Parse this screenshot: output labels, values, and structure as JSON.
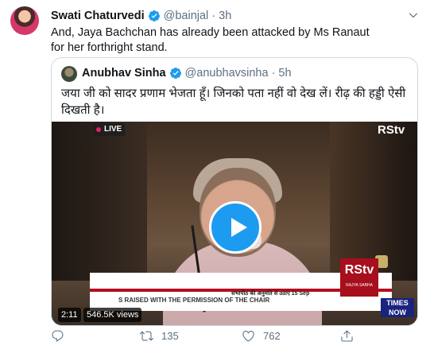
{
  "tweet": {
    "author_name": "Swati Chaturvedi",
    "author_handle": "@bainjal",
    "separator": "·",
    "time": "3h",
    "text": "And, Jaya Bachchan has already been attacked by Ms Ranaut for her forthright stand."
  },
  "quoted": {
    "author_name": "Anubhav Sinha",
    "author_handle": "@anubhavsinha",
    "separator": "·",
    "time": "5h",
    "text": "जया जी को सादर प्रणाम भेजता हूँ। जिनको पता नहीं वो देख लें। रीढ़ की हड्डी ऐसी दिखती है।",
    "video": {
      "live_label": "LIVE",
      "channel_top": "RStv",
      "channel_logo": "RStv",
      "channel_sub": "RAJYA SABHA",
      "ticker_text": "S RAISED WITH THE PERMISSION OF THE CHAIR",
      "ticker_hindi": "सभापीठ की अनुमति से उठाए 15 Sep",
      "overlay_logo": "TIMES NOW",
      "duration": "2:11",
      "views": "546.5K views"
    }
  },
  "actions": {
    "reply_count": "",
    "retweet_count": "135",
    "like_count": "762"
  },
  "colors": {
    "accent": "#1d9bf0",
    "secondary_text": "#5b7083",
    "border": "#cfd9de"
  },
  "icons": [
    "verified-icon",
    "caret-down-icon",
    "play-icon",
    "reply-icon",
    "retweet-icon",
    "like-icon",
    "share-icon"
  ]
}
